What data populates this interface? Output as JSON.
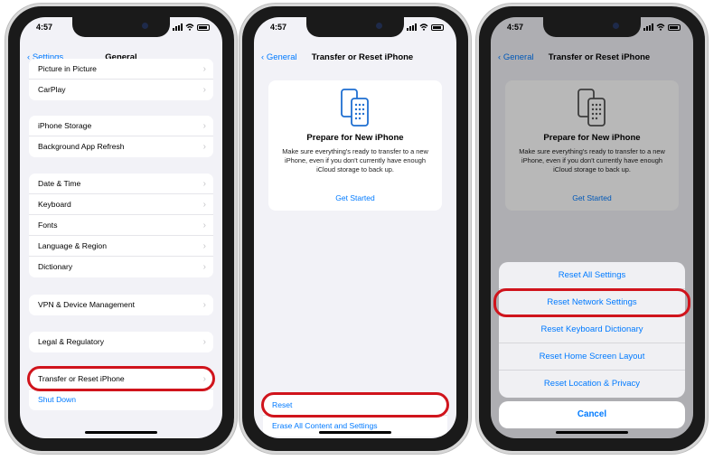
{
  "colors": {
    "accent": "#007aff",
    "highlight": "#d0141c",
    "background": "#f2f2f7"
  },
  "status_time": "4:57",
  "phone1": {
    "back_label": "Settings",
    "title": "General",
    "groups": [
      [
        "Picture in Picture",
        "CarPlay"
      ],
      [
        "iPhone Storage",
        "Background App Refresh"
      ],
      [
        "Date & Time",
        "Keyboard",
        "Fonts",
        "Language & Region",
        "Dictionary"
      ],
      [
        "VPN & Device Management"
      ],
      [
        "Legal & Regulatory"
      ]
    ],
    "transfer_label": "Transfer or Reset iPhone",
    "shutdown_label": "Shut Down"
  },
  "phone2": {
    "back_label": "General",
    "title": "Transfer or Reset iPhone",
    "card_title": "Prepare for New iPhone",
    "card_text": "Make sure everything's ready to transfer to a new iPhone, even if you don't currently have enough iCloud storage to back up.",
    "card_link": "Get Started",
    "reset_label": "Reset",
    "erase_label": "Erase All Content and Settings"
  },
  "phone3": {
    "back_label": "General",
    "title": "Transfer or Reset iPhone",
    "card_title": "Prepare for New iPhone",
    "card_text": "Make sure everything's ready to transfer to a new iPhone, even if you don't currently have enough iCloud storage to back up.",
    "card_link": "Get Started",
    "sheet_options": [
      "Reset All Settings",
      "Reset Network Settings",
      "Reset Keyboard Dictionary",
      "Reset Home Screen Layout",
      "Reset Location & Privacy"
    ],
    "cancel_label": "Cancel"
  }
}
